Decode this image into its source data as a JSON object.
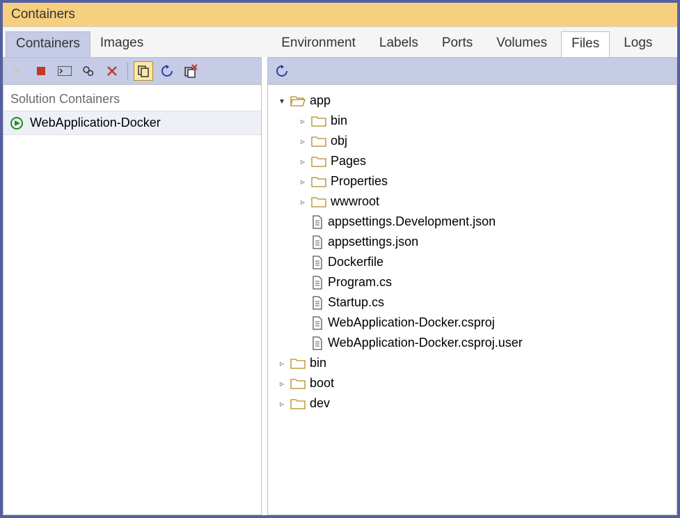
{
  "window_title": "Containers",
  "left_tabs": [
    {
      "label": "Containers",
      "active": true
    },
    {
      "label": "Images",
      "active": false
    }
  ],
  "right_tabs": [
    {
      "label": "Environment",
      "active": false
    },
    {
      "label": "Labels",
      "active": false
    },
    {
      "label": "Ports",
      "active": false
    },
    {
      "label": "Volumes",
      "active": false
    },
    {
      "label": "Files",
      "active": true
    },
    {
      "label": "Logs",
      "active": false
    }
  ],
  "solution_header": "Solution Containers",
  "containers": [
    {
      "name": "WebApplication-Docker"
    }
  ],
  "tree": {
    "root": "app",
    "root_children": {
      "folders": [
        "bin",
        "obj",
        "Pages",
        "Properties",
        "wwwroot"
      ],
      "files": [
        "appsettings.Development.json",
        "appsettings.json",
        "Dockerfile",
        "Program.cs",
        "Startup.cs",
        "WebApplication-Docker.csproj",
        "WebApplication-Docker.csproj.user"
      ]
    },
    "siblings": [
      "bin",
      "boot",
      "dev"
    ]
  }
}
